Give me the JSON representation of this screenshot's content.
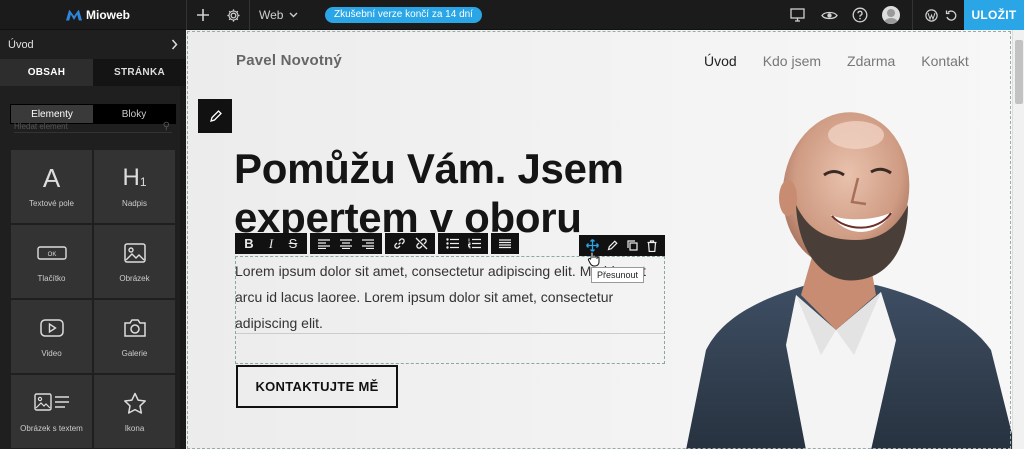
{
  "topbar": {
    "brand": "Mioweb",
    "web_label": "Web",
    "trial_badge": "Zkušební verze končí za 14 dní",
    "save_label": "ULOŽIT",
    "icons": [
      "plus-icon",
      "gear-icon",
      "monitor-icon",
      "eye-icon",
      "help-icon",
      "avatar",
      "wordpress-icon",
      "undo-icon"
    ]
  },
  "sidebar": {
    "breadcrumb": "Úvod",
    "tabs": [
      {
        "label": "OBSAH",
        "active": true
      },
      {
        "label": "STRÁNKA",
        "active": false
      }
    ],
    "segment": [
      {
        "label": "Elementy",
        "active": true
      },
      {
        "label": "Bloky",
        "active": false
      }
    ],
    "search_placeholder": "Hledat element",
    "elements": [
      {
        "label": "Textové pole",
        "icon": "text-icon"
      },
      {
        "label": "Nadpis",
        "icon": "heading-icon"
      },
      {
        "label": "Tlačítko",
        "icon": "button-icon"
      },
      {
        "label": "Obrázek",
        "icon": "image-icon"
      },
      {
        "label": "Video",
        "icon": "video-icon"
      },
      {
        "label": "Galerie",
        "icon": "camera-icon"
      },
      {
        "label": "Obrázek s textem",
        "icon": "image-text-icon"
      },
      {
        "label": "Ikona",
        "icon": "star-icon"
      }
    ]
  },
  "site": {
    "name": "Pavel Novotný",
    "nav": [
      {
        "label": "Úvod",
        "current": true
      },
      {
        "label": "Kdo jsem",
        "current": false
      },
      {
        "label": "Zdarma",
        "current": false
      },
      {
        "label": "Kontakt",
        "current": false
      }
    ],
    "hero_title": "Pomůžu Vám. Jsem expertem v oboru",
    "paragraph": "Lorem ipsum dolor sit amet, consectetur adipiscing elit. Morbi eget arcu id lacus laoree. Lorem ipsum dolor sit amet, consectetur adipiscing elit.",
    "cta_label": "KONTAKTUJTE MĚ",
    "tooltip": "Přesunout"
  },
  "colors": {
    "accent": "#2aa6e6",
    "topbar_bg": "#1b1b1b",
    "sidebar_bg": "#1f1f1f",
    "tile_bg": "#333333",
    "heading": "#151515"
  }
}
